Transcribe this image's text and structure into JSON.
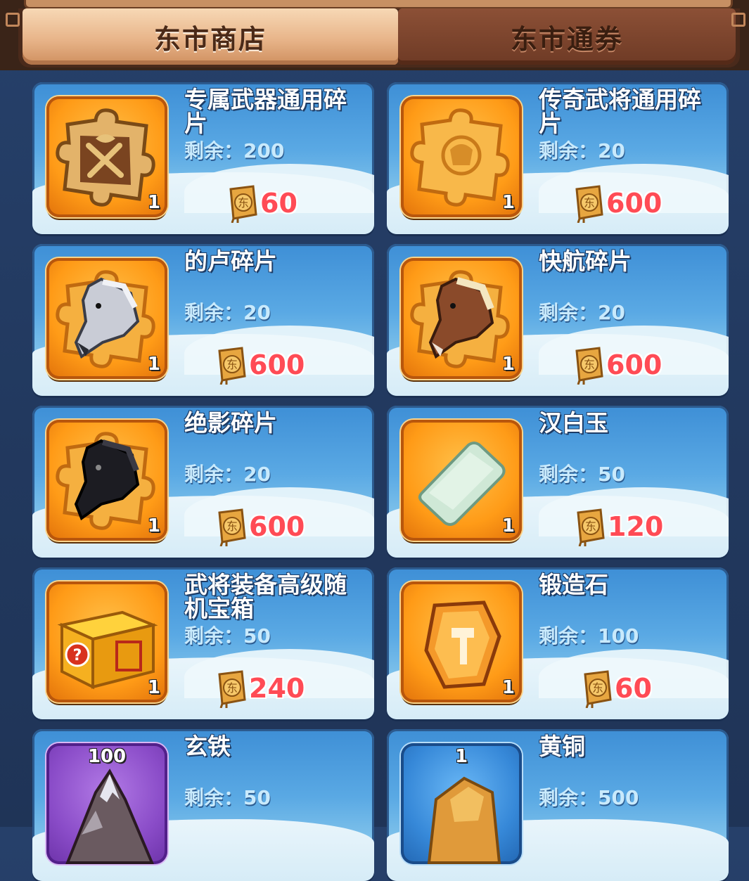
{
  "tabs": {
    "shop_label": "东市商店",
    "voucher_label": "东市通券"
  },
  "currency_icon": "dongshi-voucher-coin-icon",
  "items": [
    {
      "name": "专属武器通用碎片",
      "remain": "剩余：200",
      "price": "60",
      "qty": "1",
      "icon": "weapon-fragment-puzzle-icon"
    },
    {
      "name": "传奇武将通用碎片",
      "remain": "剩余：20",
      "price": "600",
      "qty": "1",
      "icon": "general-fragment-puzzle-icon"
    },
    {
      "name": "的卢碎片",
      "remain": "剩余：20",
      "price": "600",
      "qty": "1",
      "icon": "dilu-horse-puzzle-icon"
    },
    {
      "name": "快航碎片",
      "remain": "剩余：20",
      "price": "600",
      "qty": "1",
      "icon": "kuaihang-horse-puzzle-icon"
    },
    {
      "name": "绝影碎片",
      "remain": "剩余：20",
      "price": "600",
      "qty": "1",
      "icon": "jueying-horse-puzzle-icon"
    },
    {
      "name": "汉白玉",
      "remain": "剩余：50",
      "price": "120",
      "qty": "1",
      "icon": "white-jade-icon"
    },
    {
      "name": "武将装备高级随机宝箱",
      "remain": "剩余：50",
      "price": "240",
      "qty": "1",
      "icon": "mystery-chest-icon"
    },
    {
      "name": "锻造石",
      "remain": "剩余：100",
      "price": "60",
      "qty": "1",
      "icon": "forging-stone-icon"
    },
    {
      "name": "玄铁",
      "remain": "剩余：50",
      "price": "",
      "qty": "100",
      "icon": "dark-iron-ore-icon"
    },
    {
      "name": "黄铜",
      "remain": "剩余：500",
      "price": "",
      "qty": "1",
      "icon": "brass-ore-icon"
    }
  ],
  "colors": {
    "price": "#ff4b55",
    "card_bg": "#5aa9e4",
    "icon_bg_orange": "#ff9b17",
    "icon_bg_purple": "#8a4cc8",
    "icon_bg_blue": "#3688d8"
  }
}
